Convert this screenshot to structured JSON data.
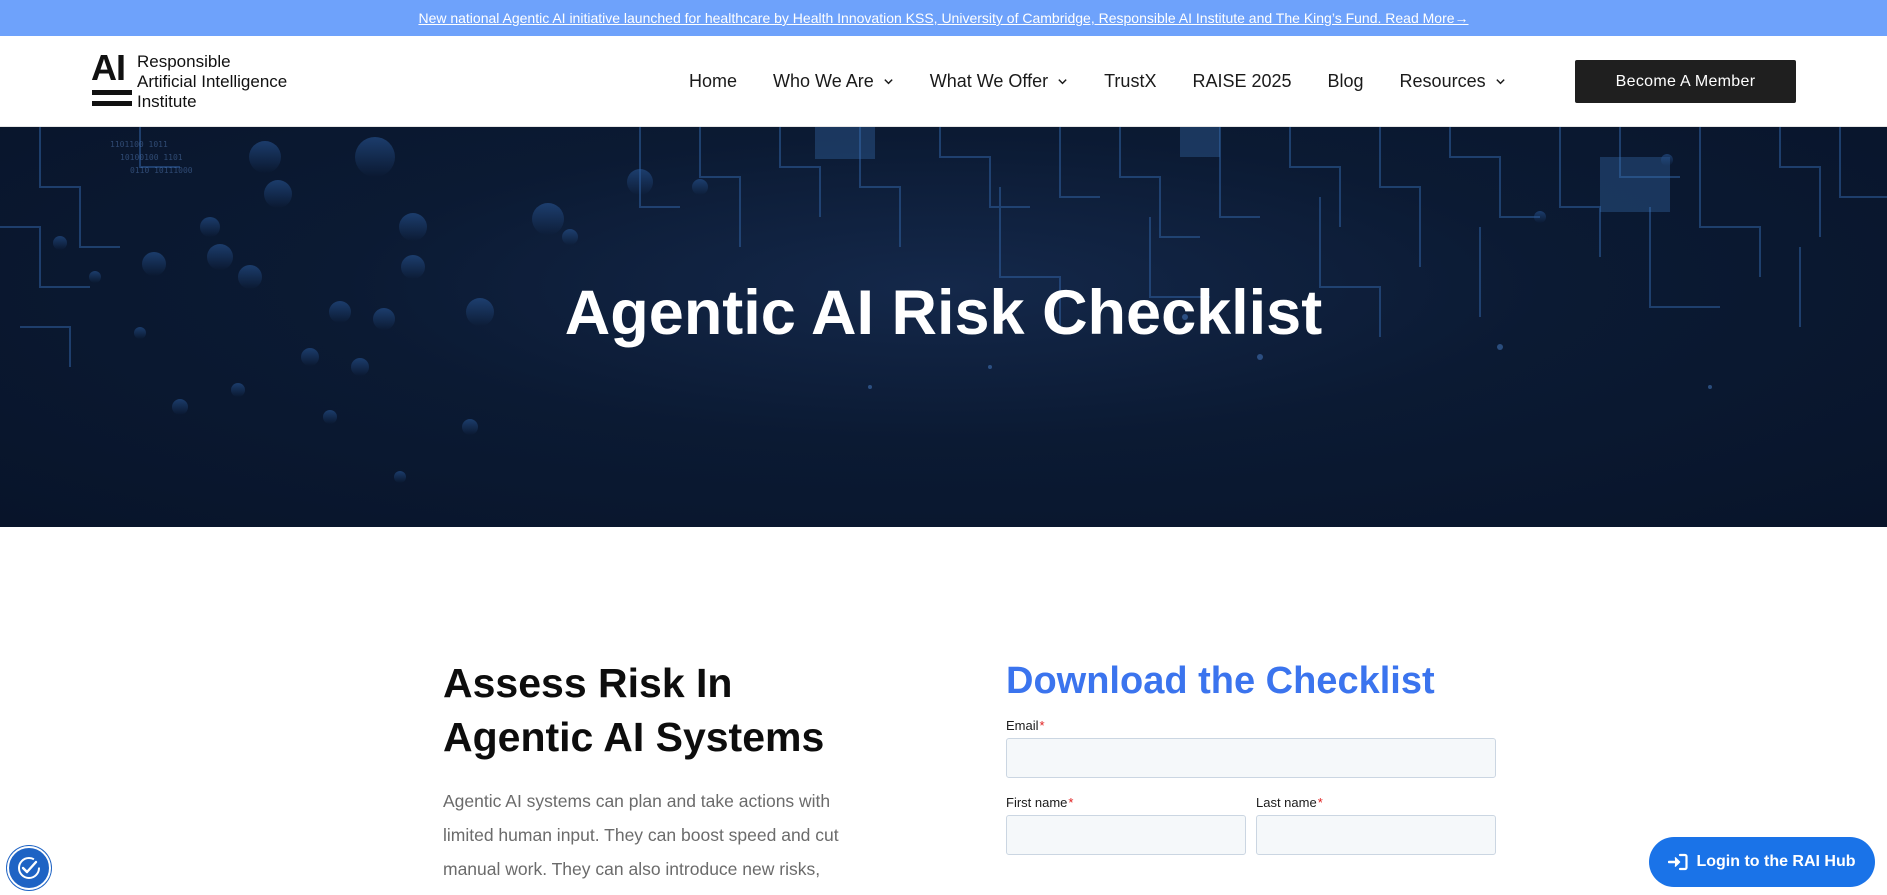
{
  "announcement": {
    "text": "New national Agentic AI initiative launched for healthcare by Health Innovation KSS, University of Cambridge, Responsible AI Institute and The King’s Fund. Read More→"
  },
  "header": {
    "logo_mark": "AI",
    "logo_lines": [
      "Responsible",
      "Artificial Intelligence",
      "Institute"
    ],
    "nav": [
      {
        "label": "Home",
        "dropdown": false
      },
      {
        "label": "Who We Are",
        "dropdown": true
      },
      {
        "label": "What We Offer",
        "dropdown": true
      },
      {
        "label": "TrustX",
        "dropdown": false
      },
      {
        "label": "RAISE 2025",
        "dropdown": false
      },
      {
        "label": "Blog",
        "dropdown": false
      },
      {
        "label": "Resources",
        "dropdown": true
      }
    ],
    "cta_label": "Become A Member"
  },
  "hero": {
    "title": "Agentic AI Risk Checklist"
  },
  "main": {
    "heading_line1": "Assess Risk In",
    "heading_line2": "Agentic AI Systems",
    "body": "Agentic AI systems can plan and take actions with limited human input. They can boost speed and cut manual work. They can also introduce new risks,"
  },
  "form": {
    "title": "Download the Checklist",
    "email_label": "Email",
    "first_name_label": "First name",
    "last_name_label": "Last name",
    "required_marker": "*",
    "email_value": "",
    "first_name_value": "",
    "last_name_value": ""
  },
  "widgets": {
    "login_label": "Login to the RAI Hub",
    "accessibility_icon": "accessibility-check-icon",
    "login_icon": "sign-in-icon"
  },
  "colors": {
    "announcement_bg": "#6ea2fb",
    "hero_bg": "#0b1a33",
    "form_title": "#3b74ee",
    "login_button": "#1a73e8",
    "member_button": "#1f1f1f"
  }
}
